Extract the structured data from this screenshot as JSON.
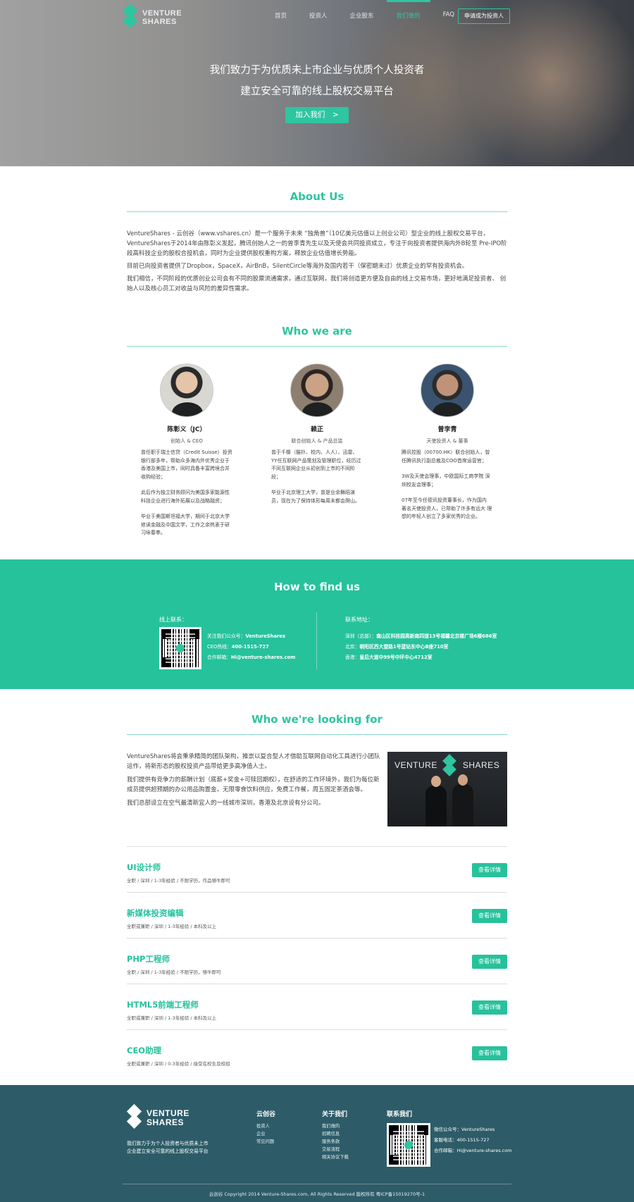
{
  "brand": {
    "logo_line1": "VENTURE",
    "logo_line2": "SHARES"
  },
  "nav": {
    "items": [
      "首页",
      "投资人",
      "企业股东",
      "我们做的",
      "FAQ"
    ],
    "active_index": 3,
    "apply_label": "申请成为投资人"
  },
  "hero": {
    "line1": "我们致力于为优质未上市企业与优质个人投资者",
    "line2": "建立安全可靠的线上股权交易平台",
    "cta": "加入我们　>"
  },
  "about": {
    "title": "About Us",
    "paragraphs": [
      "VentureShares - 云创谷（www.vshares.cn）是一个服务于未来 “独角兽”（10亿美元估值以上创业公司）型企业的线上股权交易平台，VentureShares于2014年由陈彰义发起，腾讯创始人之一的曾李青先生以及天使会共同投资成立，专注于向投资者提供海内外B轮至 Pre-IPO阶段高科技企业的股权合投机会，同时为企业提供股权重构方案，释放企业估值增长势能。",
      "目前已向投资者提供了Dropbox，SpaceX，AirBnB，SilentCircle等海外及国内若干（保密期未过）优质企业的罕有投资机会。",
      "我们相信，不同阶段的优质创业公司会有不同的股票流通需求，通过互联网，我们将创造更方便及自由的线上交易市场，更好地满足投资者、 创始人以及核心员工对收益与风险的差异性需求。"
    ]
  },
  "who": {
    "title": "Who we are",
    "people": [
      {
        "name": "陈彰义（JC）",
        "role": "创始人 & CEO",
        "desc": [
          "曾任职于瑞士信贷（Credit Suisse）投资银行部多年，帮助众多海内外优秀企业于香港及美国上市，同时具备丰富跨境合并收购经验；",
          "此后作为独立财务顾问为美国多家能源性科技企业进行海外拓展以及战略融资；",
          "毕业于美国斯坦福大学，期间于北京大学修读金融及中国文学，工作之余热衷于研习咏春拳。"
        ]
      },
      {
        "name": "赖正",
        "role": "联合创始人 & 产品总监",
        "desc": [
          "曾于千橡（猫扑、校内、人人）、迅雷、YY任互联网产品策划及管理职位，经历过不同互联网企业从初创到上市的不同阶段；",
          "毕业于北京理工大学，曾是业余舞蹈演员，现在为了保持体形每周末都会爬山。"
        ]
      },
      {
        "name": "曾李青",
        "role": "天使投资人 & 董事",
        "desc": [
          "腾讯控股（00700.HK）联合创始人，曾任腾讯执行副总裁及COO首席运营官；",
          "3W及天使会理事，中欧国际工商学院 深圳校友会理事；",
          "07年至今任德讯投资董事长，作为国内 著名天使投资人，已帮助了许多有远大 理想的年轻人创立了多家优秀的企业。"
        ]
      }
    ]
  },
  "find": {
    "title": "How to find us",
    "online_label": "线上联系：",
    "online": [
      {
        "k": "关注我们公众号：",
        "v": "VentureShares"
      },
      {
        "k": "CEO热线：",
        "v": "400-1515-727"
      },
      {
        "k": "合作邮箱：",
        "v": "Hi@venture-shares.com"
      }
    ],
    "address_label": "联系地址：",
    "addresses": [
      {
        "k": "深圳（总部）：",
        "v": "南山区科技园高新南四道13号福馨北京楼广场6楼686室"
      },
      {
        "k": "北京：",
        "v": "朝阳区西大望路1号蓝钻东中心B座710室"
      },
      {
        "k": "香港：",
        "v": "皇后大道中99号中环中心4712室"
      }
    ]
  },
  "looking": {
    "title": "Who we're looking for",
    "paragraphs": [
      "VentureShares将会秉承精简的团队架构，推崇以复合型人才借助互联网自动化工具进行小团队运作，将新形态的股权投资产品带给更多高净值人士。",
      "我们提供有竞争力的薪酬计划（底薪+奖金+可赎回期权），在舒适的工作环境外，我们为每位新成员提供超预期的办公用品购置金，无限零食饮料供应，免费工作餐，周五固定茶酒会等。",
      "我们总部设立在空气最清新宜人的一线城市深圳，香港及北京设有分公司。"
    ],
    "image_caption_left": "VENTURE",
    "image_caption_right": "SHARES",
    "detail_label": "查看详情",
    "jobs": [
      {
        "title": "UI设计师",
        "meta": "全职 / 深圳 / 1-3年经验 / 不限学历，作品够牛即可"
      },
      {
        "title": "新媒体投资编辑",
        "meta": "全职或兼职 / 深圳 / 1-3年经验 / 本科及以上"
      },
      {
        "title": "PHP工程师",
        "meta": "全职 / 深圳 / 1-3年经验 / 不限学历，够牛即可"
      },
      {
        "title": "HTML5前端工程师",
        "meta": "全职或兼职 / 深圳 / 1-3年经验 / 本科及以上"
      },
      {
        "title": "CEO助理",
        "meta": "全职或兼职 / 深圳 / 0-3年经验 / 接受在校生及校招"
      }
    ]
  },
  "footer": {
    "slogan1": "我们致力于为个人投资者与优质未上市",
    "slogan2": "企业建立安全可靠的线上股权交易平台",
    "col1": {
      "title": "云创谷",
      "items": [
        "投资人",
        "企业",
        "常见问题"
      ]
    },
    "col2": {
      "title": "关于我们",
      "items": [
        "我们做的",
        "招聘信息",
        "服务条款",
        "交易流程",
        "相关协议下载"
      ]
    },
    "col3": {
      "title": "联系我们",
      "items": [
        {
          "k": "微信公众号：",
          "v": "VentureShares"
        },
        {
          "k": "客服电话：",
          "v": "400-1515-727"
        },
        {
          "k": "合作邮箱：",
          "v": "Hi@venture-shares.com"
        }
      ]
    },
    "copyright": "云创谷 Copyright 2014 Venture-Shares.com, All Rights Reserved 版权所有 粤ICP备15019270号-1"
  },
  "colors": {
    "accent": "#2ec5a0",
    "find_bg": "#26c29c",
    "footer_bg": "#2d5c68"
  },
  "icons": [
    "venture-shares-logo-icon",
    "qr-code-icon"
  ]
}
